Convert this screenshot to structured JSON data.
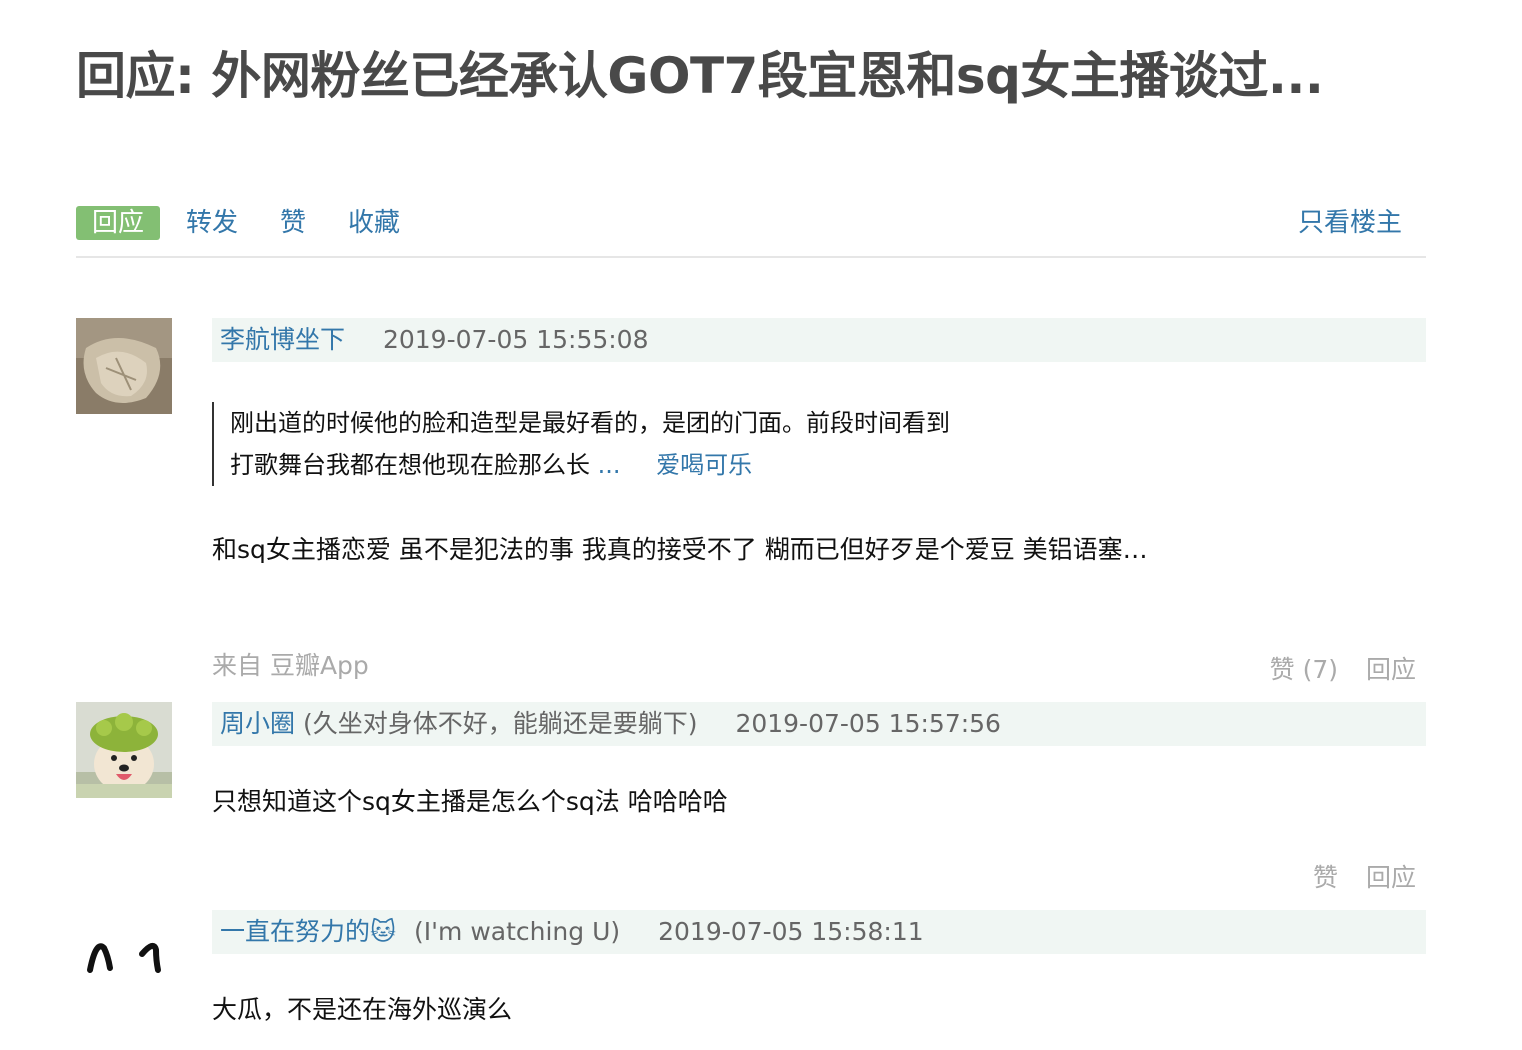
{
  "title": "回应: 外网粉丝已经承认GOT7段宜恩和sq女主播谈过...",
  "actions": {
    "reply": "回应",
    "forward": "转发",
    "like": "赞",
    "collect": "收藏",
    "only_op": "只看楼主"
  },
  "comments": [
    {
      "author": "李航博坐下",
      "time": "2019-07-05 15:55:08",
      "quote_line1": "刚出道的时候他的脸和造型是最好看的，是团的门面。前段时间看到",
      "quote_line2": "打歌舞台我都在想他现在脸那么长",
      "quote_ellipsis": "...",
      "quote_author": "爱喝可乐",
      "content": "和sq女主播恋爱 虽不是犯法的事 我真的接受不了 糊而已但好歹是个爱豆 美铝语塞…",
      "from": "来自 豆瓣App",
      "like": "赞 (7)",
      "reply": "回应"
    },
    {
      "author": "周小圈",
      "signature": "(久坐对身体不好，能躺还是要躺下)",
      "time": "2019-07-05 15:57:56",
      "content": "只想知道这个sq女主播是怎么个sq法 哈哈哈哈",
      "like": "赞",
      "reply": "回应"
    },
    {
      "author": "一直在努力的🐱",
      "signature": "(I'm watching U)",
      "time": "2019-07-05 15:58:11",
      "content": "大瓜，不是还在海外巡演么"
    }
  ]
}
